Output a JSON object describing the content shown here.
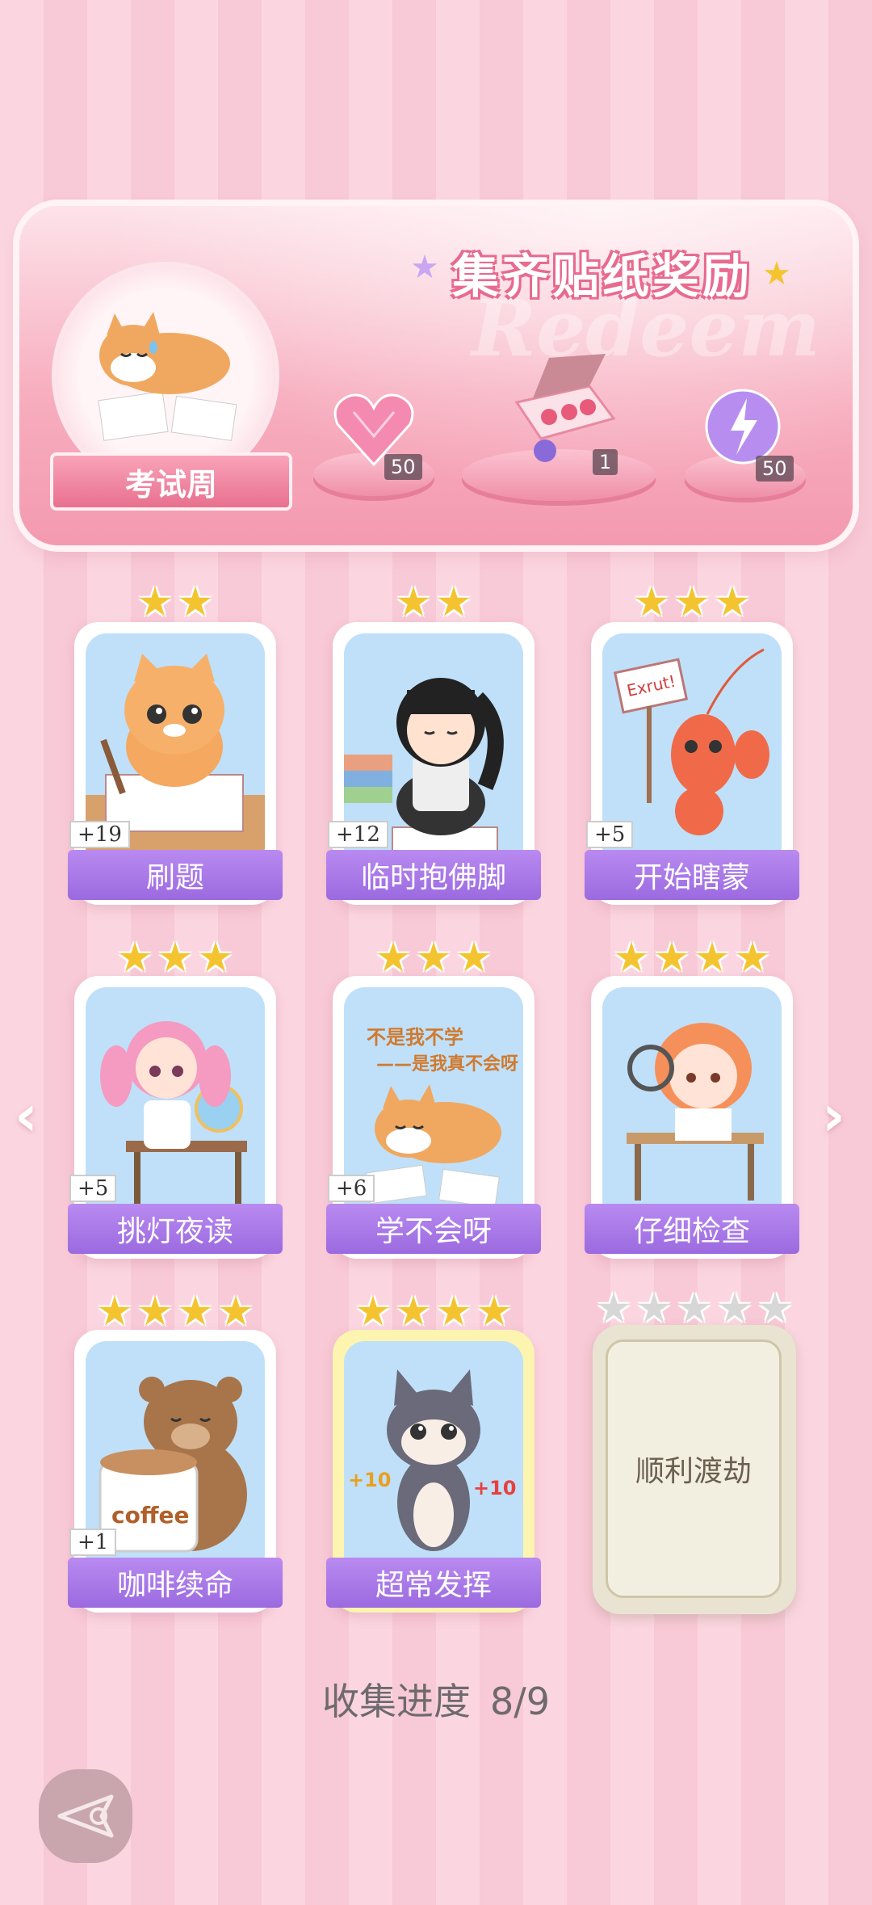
{
  "banner": {
    "title": "集齐贴纸奖励",
    "watermark": "Redeem",
    "theme_label": "考试周",
    "rewards": [
      {
        "icon": "pink-gem-heart-icon",
        "count": "50"
      },
      {
        "icon": "gift-box-icon",
        "count": "1"
      },
      {
        "icon": "lightning-orb-icon",
        "count": "50"
      }
    ]
  },
  "cards": [
    {
      "label": "刷题",
      "bonus": "+19",
      "stars": 2,
      "art": "cat-writing"
    },
    {
      "label": "临时抱佛脚",
      "bonus": "+12",
      "stars": 2,
      "art": "girl-praying"
    },
    {
      "label": "开始瞎蒙",
      "bonus": "+5",
      "stars": 3,
      "art": "shrimp-sign"
    },
    {
      "label": "挑灯夜读",
      "bonus": "+5",
      "stars": 3,
      "art": "girl-desk-night"
    },
    {
      "label": "学不会呀",
      "bonus": "+6",
      "stars": 3,
      "art": "shiba-lying"
    },
    {
      "label": "仔细检查",
      "bonus": "",
      "stars": 4,
      "art": "girl-magnifier"
    },
    {
      "label": "咖啡续命",
      "bonus": "+1",
      "stars": 4,
      "art": "bear-coffee"
    },
    {
      "label": "超常发挥",
      "bonus": "",
      "stars": 4,
      "art": "cat-celebrate"
    }
  ],
  "locked_card": {
    "label": "顺利渡劫",
    "stars": 5
  },
  "shiba_text": [
    "不是我不学",
    "——是我真不会呀"
  ],
  "shrimp_sign": "Exrut!",
  "coffee_text": "coffee",
  "celebrate_bonus": "+10",
  "progress": {
    "label": "收集进度",
    "value": "8/9"
  },
  "colors": {
    "label_purple": "#9b6ae0",
    "star_gold": "#f4c430",
    "banner_pink": "#f49ab0"
  }
}
